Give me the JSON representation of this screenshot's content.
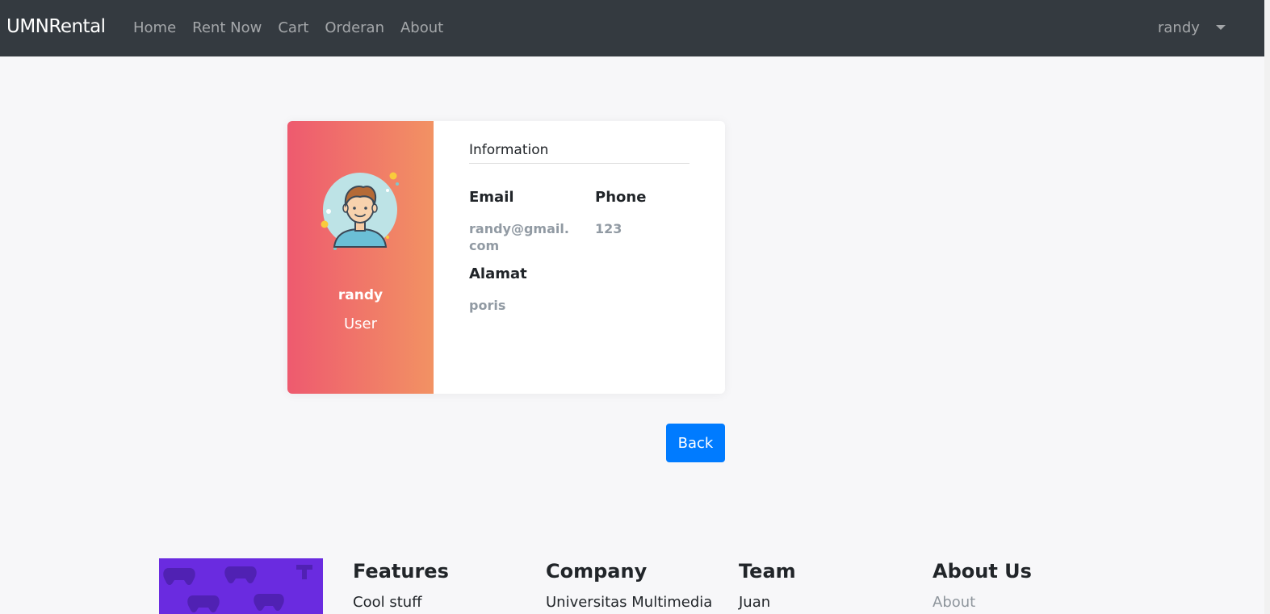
{
  "navbar": {
    "brand": "UMNRental",
    "links": [
      "Home",
      "Rent Now",
      "Cart",
      "Orderan",
      "About"
    ],
    "user": "randy"
  },
  "profile": {
    "name": "randy",
    "role": "User",
    "avatar_icon": "user-avatar-icon",
    "gradient": [
      "#ee5a6f",
      "#f29263"
    ]
  },
  "information": {
    "title": "Information",
    "email_label": "Email",
    "email_value": "randy@gmail.com",
    "phone_label": "Phone",
    "phone_value": "123",
    "address_label": "Alamat",
    "address_value": "poris"
  },
  "actions": {
    "back_label": "Back"
  },
  "footer": {
    "features": {
      "heading": "Features",
      "item": "Cool stuff"
    },
    "company": {
      "heading": "Company",
      "item": "Universitas Multimedia"
    },
    "team": {
      "heading": "Team",
      "item": "Juan"
    },
    "about": {
      "heading": "About Us",
      "item": "About"
    },
    "image_icon": "gamepad-pattern-icon"
  },
  "colors": {
    "navbar": "#343a40",
    "primary": "#007bff",
    "footer_image": "#6a2be0"
  }
}
